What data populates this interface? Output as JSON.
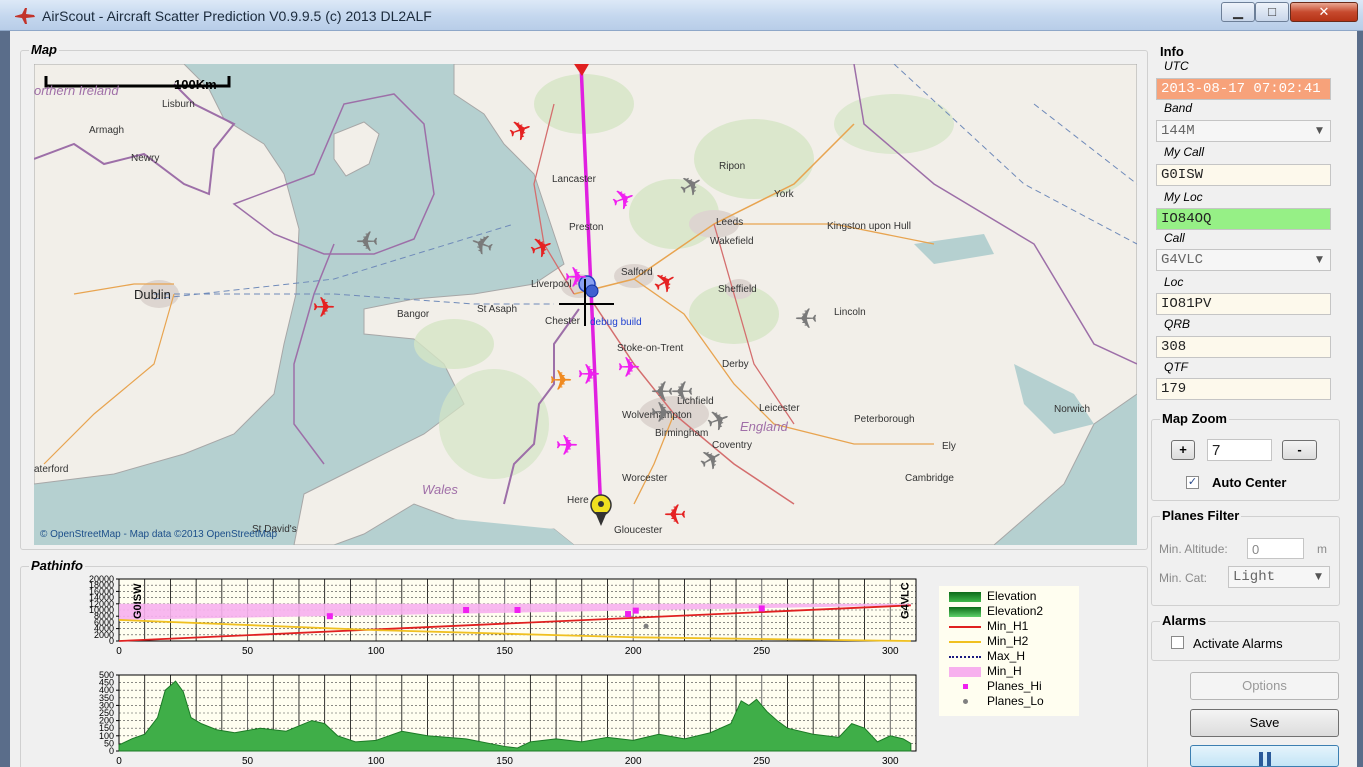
{
  "window": {
    "title": "AirScout - Aircraft Scatter Prediction V0.9.9.5 (c) 2013 DL2ALF",
    "minimize_glyph": "▁",
    "maximize_glyph": "□",
    "close_glyph": "✕"
  },
  "map": {
    "group_title": "Map",
    "scale_label": "100Km",
    "attribution": "© OpenStreetMap - Map data ©2013 OpenStreetMap",
    "debug_label": "debug build",
    "places": {
      "northern_ireland": "orthern Ireland",
      "lisburn": "Lisburn",
      "armagh": "Armagh",
      "newry": "Newry",
      "dublin": "Dublin",
      "waterford": "aterford",
      "wales": "Wales",
      "st_davids": "St David's",
      "bangor": "Bangor",
      "st_asaph": "St Asaph",
      "chester": "Chester",
      "liverpool": "Liverpool",
      "salford": "Salford",
      "lancaster": "Lancaster",
      "preston": "Preston",
      "ripon": "Ripon",
      "york": "York",
      "leeds": "Leeds",
      "wakefield": "Wakefield",
      "kingston": "Kingston upon Hull",
      "sheffield": "Sheffield",
      "lincoln": "Lincoln",
      "stoke": "Stoke-on-Trent",
      "derby": "Derby",
      "lichfield": "Lichfield",
      "wolverhampton": "Wolverhampton",
      "birmingham": "Birmingham",
      "coventry": "Coventry",
      "leicester": "Leicester",
      "peterborough": "Peterborough",
      "england": "England",
      "norwich": "Norwich",
      "ely": "Ely",
      "cambridge": "Cambridge",
      "worcester": "Worcester",
      "hereford": "Here",
      "gloucester": "Gloucester"
    },
    "plane_glyph": "✈",
    "colors": {
      "plane_hi": "#f020f0",
      "plane_red": "#e52222",
      "plane_gray": "#7a7a7a",
      "plane_orange": "#f08a20",
      "path": "#e020e0"
    }
  },
  "pathinfo": {
    "group_title": "Pathinfo",
    "left_call": "G0ISW",
    "right_call": "G4VLC",
    "legend": [
      {
        "label": "Elevation",
        "color": "#1f8a2a"
      },
      {
        "label": "Elevation2",
        "color": "#2fa83a"
      },
      {
        "label": "Min_H1",
        "color": "#e02020"
      },
      {
        "label": "Min_H2",
        "color": "#f0c020"
      },
      {
        "label": "Max_H",
        "color": "#1a1a80"
      },
      {
        "label": "Min_H",
        "color": "#f7b0ee"
      },
      {
        "label": "Planes_Hi",
        "color": "#f020f0"
      },
      {
        "label": "Planes_Lo",
        "color": "#808080"
      }
    ]
  },
  "chart_data": [
    {
      "type": "area",
      "title": "",
      "xlim": [
        0,
        310
      ],
      "ylim": [
        0,
        20000
      ],
      "x_ticks": [
        "0",
        "50",
        "100",
        "150",
        "200",
        "250",
        "300"
      ],
      "y_ticks": [
        "0",
        "4000",
        "8000",
        "12000",
        "16000",
        "20000"
      ],
      "y_minor_ticks": [
        "2000",
        "6000",
        "10000",
        "14000",
        "18000"
      ],
      "series": [
        {
          "name": "Min_H1",
          "x": [
            0,
            308
          ],
          "y": [
            0,
            11500
          ]
        },
        {
          "name": "Min_H2",
          "x": [
            0,
            100,
            200,
            308
          ],
          "y": [
            6800,
            3500,
            1200,
            0
          ]
        },
        {
          "name": "Min_H",
          "x": [
            0,
            308
          ],
          "y_low": [
            6800,
            11500
          ],
          "y_high": [
            12000,
            12000
          ]
        },
        {
          "name": "Planes_Hi",
          "x": [
            82,
            135,
            155,
            198,
            201,
            250
          ],
          "y": [
            8000,
            10000,
            10000,
            8700,
            9800,
            10500
          ]
        },
        {
          "name": "Planes_Lo",
          "x": [
            205
          ],
          "y": [
            4800
          ]
        }
      ]
    },
    {
      "type": "area",
      "title": "",
      "xlim": [
        0,
        310
      ],
      "ylim": [
        0,
        500
      ],
      "x_ticks": [
        "0",
        "50",
        "100",
        "150",
        "200",
        "250",
        "300"
      ],
      "y_ticks": [
        "0",
        "100",
        "200",
        "300",
        "400",
        "500"
      ],
      "y_minor_ticks": [
        "50",
        "150",
        "250",
        "350",
        "450"
      ],
      "series": [
        {
          "name": "Elevation",
          "x": [
            0,
            5,
            10,
            15,
            18,
            22,
            25,
            28,
            32,
            38,
            45,
            55,
            65,
            75,
            80,
            85,
            92,
            100,
            110,
            120,
            135,
            150,
            155,
            160,
            170,
            180,
            190,
            200,
            210,
            220,
            230,
            238,
            242,
            245,
            248,
            252,
            256,
            260,
            270,
            280,
            285,
            290,
            295,
            300,
            305,
            308
          ],
          "y": [
            40,
            80,
            110,
            220,
            400,
            460,
            390,
            220,
            180,
            140,
            120,
            150,
            130,
            200,
            180,
            100,
            60,
            70,
            130,
            100,
            80,
            30,
            20,
            60,
            80,
            60,
            90,
            70,
            110,
            80,
            120,
            180,
            330,
            300,
            340,
            260,
            200,
            150,
            110,
            90,
            180,
            150,
            60,
            100,
            80,
            50
          ]
        }
      ]
    }
  ],
  "info": {
    "group_title": "Info",
    "utc_label": "UTC",
    "utc_value": "2013-08-17 07:02:41",
    "band_label": "Band",
    "band_value": "144M",
    "mycall_label": "My Call",
    "mycall_value": "G0ISW",
    "myloc_label": "My Loc",
    "myloc_value": "IO84OQ",
    "call_label": "Call",
    "call_value": "G4VLC",
    "loc_label": "Loc",
    "loc_value": "IO81PV",
    "qrb_label": "QRB",
    "qrb_value": "308",
    "qtf_label": "QTF",
    "qtf_value": "179"
  },
  "zoom": {
    "group_title": "Map Zoom",
    "plus_label": "+",
    "minus_label": "-",
    "value": "7",
    "auto_center_label": "Auto Center",
    "auto_center_checked": "✓"
  },
  "filter": {
    "group_title": "Planes Filter",
    "min_alt_label": "Min. Altitude:",
    "min_alt_value": "0",
    "min_alt_unit": "m",
    "min_cat_label": "Min. Cat:",
    "min_cat_value": "Light"
  },
  "alarms": {
    "group_title": "Alarms",
    "activate_label": "Activate Alarms"
  },
  "buttons": {
    "options_label": "Options",
    "save_label": "Save"
  }
}
